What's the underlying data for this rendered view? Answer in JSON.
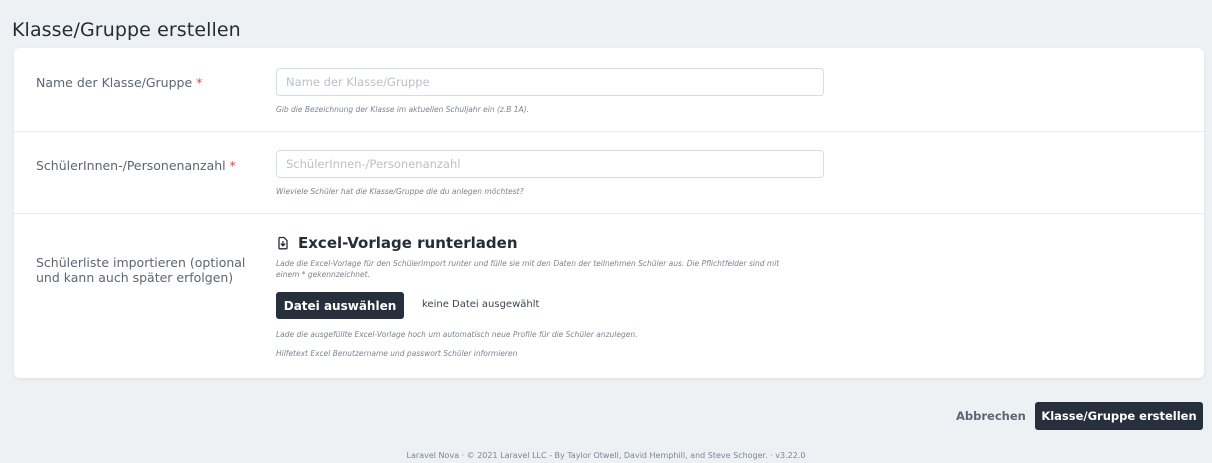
{
  "page": {
    "title": "Klasse/Gruppe erstellen"
  },
  "fields": {
    "name": {
      "label": "Name der Klasse/Gruppe",
      "required_mark": "*",
      "placeholder": "Name der Klasse/Gruppe",
      "value": "",
      "help": "Gib die Bezeichnung der Klasse im aktuellen Schuljahr ein (z.B 1A)."
    },
    "count": {
      "label": "SchülerInnen-/Personenanzahl",
      "required_mark": "*",
      "placeholder": "SchülerInnen-/Personenanzahl",
      "value": "",
      "help": "Wieviele Schüler hat die Klasse/Gruppe die du anlegen möchtest?"
    },
    "import": {
      "label_line1": "Schülerliste importieren (optional",
      "label_line2": "und kann auch später erfolgen)",
      "download_label": "Excel-Vorlage runterladen",
      "download_icon": "download-file-icon",
      "download_help_line1": "Lade die Excel-Vorlage für den Schülerimport runter und fülle sie mit den Daten der teilnehmen Schüler aus. Die Pflichtfelder sind mit",
      "download_help_line2": "einem * gekennzeichnet.",
      "file_button_label": "Datei auswählen",
      "file_status": "keine Datei ausgewählt",
      "upload_help": "Lade die ausgefüllte Excel-Vorlage hoch um automatisch neue Profile für die Schüler anzulegen.",
      "extra_help": "Hilfetext Excel Benutzername und passwort Schüler informieren"
    }
  },
  "actions": {
    "cancel_label": "Abbrechen",
    "submit_label": "Klasse/Gruppe erstellen"
  },
  "footer": {
    "text": "Laravel Nova · © 2021 Laravel LLC - By Taylor Otwell, David Hemphill, and Steve Schoger. · v3.22.0"
  },
  "colors": {
    "background": "#eef1f4",
    "primary_button": "#272f3d",
    "required": "#e74444"
  }
}
